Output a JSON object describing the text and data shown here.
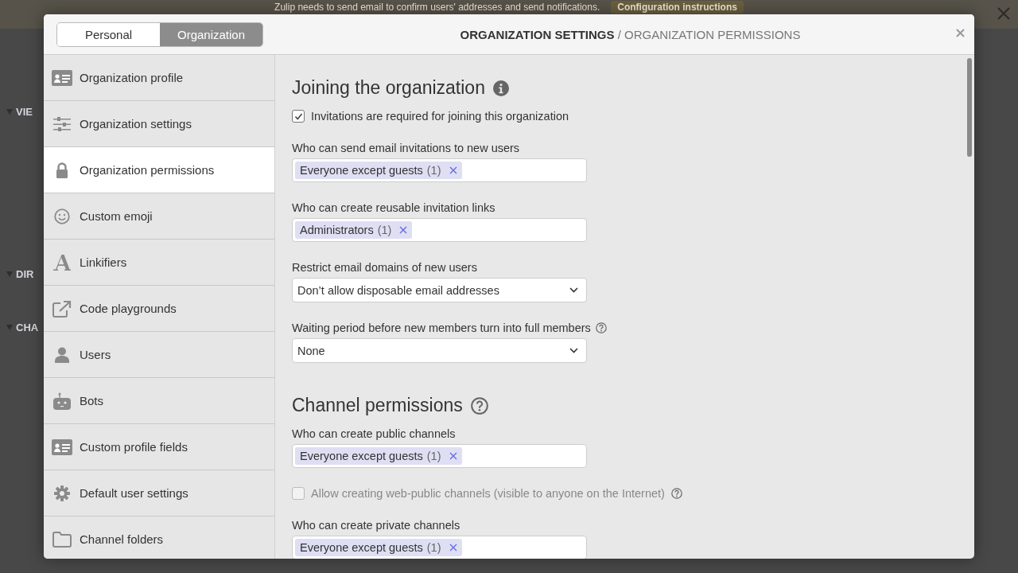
{
  "background": {
    "banner": {
      "text": "Zulip needs to send email to confirm users' addresses and send notifications.",
      "button": "Configuration instructions"
    },
    "sidebar_headings": [
      "VIE",
      "DIR",
      "CHA"
    ]
  },
  "modal": {
    "tabs": [
      {
        "label": "Personal",
        "selected": false
      },
      {
        "label": "Organization",
        "selected": true
      }
    ],
    "title": "**ORGANIZATION SETTINGS** / ORGANIZATION PERMISSIONS",
    "sidebar": {
      "items": [
        {
          "label": "Organization profile",
          "selected": false
        },
        {
          "label": "Organization settings",
          "selected": false
        },
        {
          "label": "Organization permissions",
          "selected": true
        },
        {
          "label": "Custom emoji",
          "selected": false
        },
        {
          "label": "Linkifiers",
          "selected": false
        },
        {
          "label": "Code playgrounds",
          "selected": false
        },
        {
          "label": "Users",
          "selected": false
        },
        {
          "label": "Bots",
          "selected": false
        },
        {
          "label": "Custom profile fields",
          "selected": false
        },
        {
          "label": "Default user settings",
          "selected": false
        },
        {
          "label": "Channel folders",
          "selected": false
        }
      ]
    },
    "sections": [
      {
        "heading": "Joining the organization",
        "settings": [
          {
            "kind": "checkbox",
            "label": "Invitations are required for joining this organization",
            "checked": true,
            "disabled": false,
            "help": false
          },
          {
            "kind": "pills",
            "label": "Who can send email invitations to new users",
            "pills": [
              {
                "name": "Everyone except guests",
                "count": "(1)"
              }
            ]
          },
          {
            "kind": "pills",
            "label": "Who can create reusable invitation links",
            "pills": [
              {
                "name": "Administrators",
                "count": "(1)"
              }
            ]
          },
          {
            "kind": "select",
            "label": "Restrict email domains of new users",
            "value": "Don’t allow disposable email addresses",
            "help": false
          },
          {
            "kind": "select",
            "label": "Waiting period before new members turn into full members",
            "value": "None",
            "help": true
          }
        ]
      },
      {
        "heading": "Channel permissions",
        "settings": [
          {
            "kind": "pills",
            "label": "Who can create public channels",
            "pills": [
              {
                "name": "Everyone except guests",
                "count": "(1)"
              }
            ]
          },
          {
            "kind": "checkbox",
            "label": "Allow creating web-public channels (visible to anyone on the Internet)",
            "checked": false,
            "disabled": true,
            "help": true
          },
          {
            "kind": "pills",
            "label": "Who can create private channels",
            "pills": [
              {
                "name": "Everyone except guests",
                "count": "(1)"
              }
            ]
          }
        ]
      }
    ]
  }
}
